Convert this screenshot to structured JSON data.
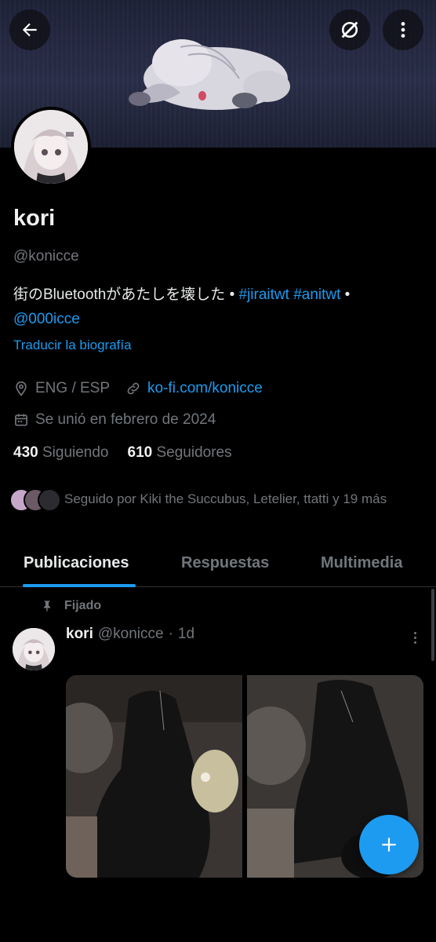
{
  "profile": {
    "name": "kori",
    "handle": "@konicce",
    "bio_text": "街のBluetoothがあたしを壊した • ",
    "bio_hashtag1": "#jiraitwt",
    "bio_hashtag2": "#anitwt",
    "bio_sep": " • ",
    "bio_mention": "@000icce",
    "translate_label": "Traducir la biografía",
    "location": "ENG / ESP",
    "website": "ko-fi.com/konicce",
    "joined": "Se unió en febrero de 2024",
    "following_count": "430",
    "following_label": "Siguiendo",
    "followers_count": "610",
    "followers_label": "Seguidores",
    "followed_by": "Seguido por Kiki the Succubus, Letelier, ttatti y 19 más"
  },
  "tabs": [
    {
      "label": "Publicaciones",
      "active": true
    },
    {
      "label": "Respuestas",
      "active": false
    },
    {
      "label": "Multimedia",
      "active": false
    }
  ],
  "pinned_post": {
    "pinned_label": "Fijado",
    "author_name": "kori",
    "author_handle": "@konicce",
    "separator": "·",
    "time": "1d"
  },
  "icons": {
    "back": "back-arrow-icon",
    "grok": "grok-icon",
    "more": "more-vertical-icon",
    "location": "location-icon",
    "link": "link-icon",
    "calendar": "calendar-icon",
    "pin": "pin-icon",
    "compose": "plus-icon"
  },
  "colors": {
    "accent": "#1d9bf0",
    "background": "#000000",
    "muted": "#71767b"
  }
}
